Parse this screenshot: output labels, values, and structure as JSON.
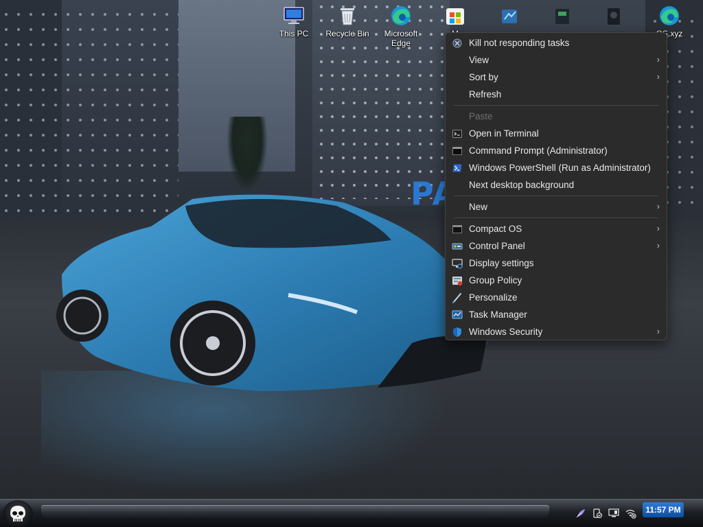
{
  "desktop": {
    "icons": [
      {
        "label": "This PC",
        "icon": "computer-icon"
      },
      {
        "label": "Recycle Bin",
        "icon": "recycle-bin-icon"
      },
      {
        "label": "Microsoft Edge",
        "icon": "edge-icon"
      },
      {
        "label": "M",
        "icon": "store-icon"
      },
      {
        "label": "",
        "icon": "app-icon"
      },
      {
        "label": "",
        "icon": "app-icon"
      },
      {
        "label": "",
        "icon": "app-icon"
      },
      {
        "label": "OS.xyz",
        "icon": "edge-icon"
      }
    ],
    "wallpaper_sign": "PA"
  },
  "context_menu": {
    "items": [
      {
        "label": "Kill not responding tasks",
        "icon": "kill-task-icon",
        "submenu": false,
        "disabled": false
      },
      {
        "label": "View",
        "icon": "",
        "submenu": true,
        "disabled": false
      },
      {
        "label": "Sort by",
        "icon": "",
        "submenu": true,
        "disabled": false
      },
      {
        "label": "Refresh",
        "icon": "",
        "submenu": false,
        "disabled": false
      },
      {
        "label": "Paste",
        "icon": "",
        "submenu": false,
        "disabled": true
      },
      {
        "label": "Open in Terminal",
        "icon": "terminal-icon",
        "submenu": false,
        "disabled": false
      },
      {
        "label": "Command Prompt (Administrator)",
        "icon": "cmd-icon",
        "submenu": false,
        "disabled": false
      },
      {
        "label": "Windows PowerShell (Run as Administrator)",
        "icon": "powershell-icon",
        "submenu": false,
        "disabled": false
      },
      {
        "label": "Next desktop background",
        "icon": "",
        "submenu": false,
        "disabled": false
      },
      {
        "label": "New",
        "icon": "",
        "submenu": true,
        "disabled": false
      },
      {
        "label": "Compact OS",
        "icon": "compact-os-icon",
        "submenu": true,
        "disabled": false
      },
      {
        "label": "Control Panel",
        "icon": "control-panel-icon",
        "submenu": true,
        "disabled": false
      },
      {
        "label": "Display settings",
        "icon": "display-settings-icon",
        "submenu": false,
        "disabled": false
      },
      {
        "label": "Group Policy",
        "icon": "group-policy-icon",
        "submenu": false,
        "disabled": false
      },
      {
        "label": "Personalize",
        "icon": "personalize-icon",
        "submenu": false,
        "disabled": false
      },
      {
        "label": "Task Manager",
        "icon": "task-manager-icon",
        "submenu": false,
        "disabled": false
      },
      {
        "label": "Windows Security",
        "icon": "windows-security-icon",
        "submenu": true,
        "disabled": false
      }
    ]
  },
  "taskbar": {
    "clock": "11:57 PM",
    "tray_icons": [
      "feather-icon",
      "power-plan-icon",
      "display-icon",
      "network-icon"
    ]
  },
  "colors": {
    "menu_bg": "#2b2b2b",
    "menu_text": "#e8e8e8",
    "menu_disabled": "#6f6f6f",
    "clock_bg": "#1f6bc8"
  }
}
